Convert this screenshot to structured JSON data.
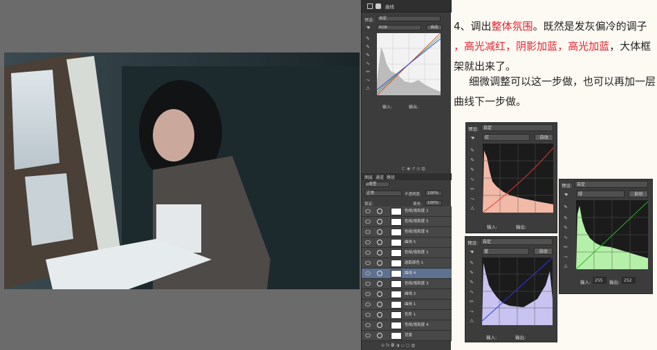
{
  "ps": {
    "tab_label": "曲线",
    "preset_label": "预设:",
    "preset_value": "自定",
    "channel_value": "RGB",
    "auto_label": "自动",
    "input_label": "输入:",
    "output_label": "输出:",
    "layers_tabs": [
      "图层",
      "通道",
      "路径"
    ],
    "kind_label": "ρ类型",
    "blend_mode": "正常",
    "opacity_label": "不透明度:",
    "opacity_value": "100%",
    "lock_label": "锁定:",
    "fill_label": "填充:",
    "fill_value": "100%",
    "layers": [
      {
        "name": "色相/饱和度 2",
        "selected": false
      },
      {
        "name": "色相/饱和度 5",
        "selected": false
      },
      {
        "name": "色相/饱和度 6",
        "selected": false
      },
      {
        "name": "曲线 5",
        "selected": false
      },
      {
        "name": "色相/饱和度 1",
        "selected": false
      },
      {
        "name": "选取颜色 1",
        "selected": false
      },
      {
        "name": "曲线 4",
        "selected": true
      },
      {
        "name": "色相/饱和度 3",
        "selected": false
      },
      {
        "name": "曲线 2",
        "selected": false
      },
      {
        "name": "曲线 1",
        "selected": false
      },
      {
        "name": "色阶 1",
        "selected": false
      },
      {
        "name": "色相/饱和度 4",
        "selected": false
      },
      {
        "name": "背景",
        "selected": false
      }
    ]
  },
  "article": {
    "p1_a": "4、调出",
    "p1_b": "整体氛围",
    "p1_c": "。既然是发灰偏冷的调子",
    "p1_d": "，",
    "p1_e": "高光减红",
    "p1_f": "，",
    "p1_g": "阴影加蓝",
    "p1_h": "，",
    "p1_i": "高光加蓝",
    "p1_j": "，大体框",
    "p1_k": "架就出来了。",
    "p2_a": "细微调整可以这一步做，也可以再加一层",
    "p2_b": "曲线下一步做。"
  },
  "panels": {
    "red": {
      "preset_label": "预设:",
      "preset_value": "自定",
      "channel": "红",
      "auto": "自动",
      "input_label": "输入:",
      "output_label": "输出:"
    },
    "blue": {
      "preset_label": "预设:",
      "preset_value": "自定",
      "channel": "蓝",
      "auto": "自动",
      "input_label": "输入:",
      "output_label": "输出:"
    },
    "green": {
      "preset_label": "预设:",
      "preset_value": "自定",
      "channel": "绿",
      "auto": "自动",
      "input_label": "输入:",
      "input_value": "255",
      "output_label": "输出:",
      "output_value": "252"
    }
  },
  "colors": {
    "accent_red": "#e8222e",
    "selected_layer": "#5e7190"
  }
}
